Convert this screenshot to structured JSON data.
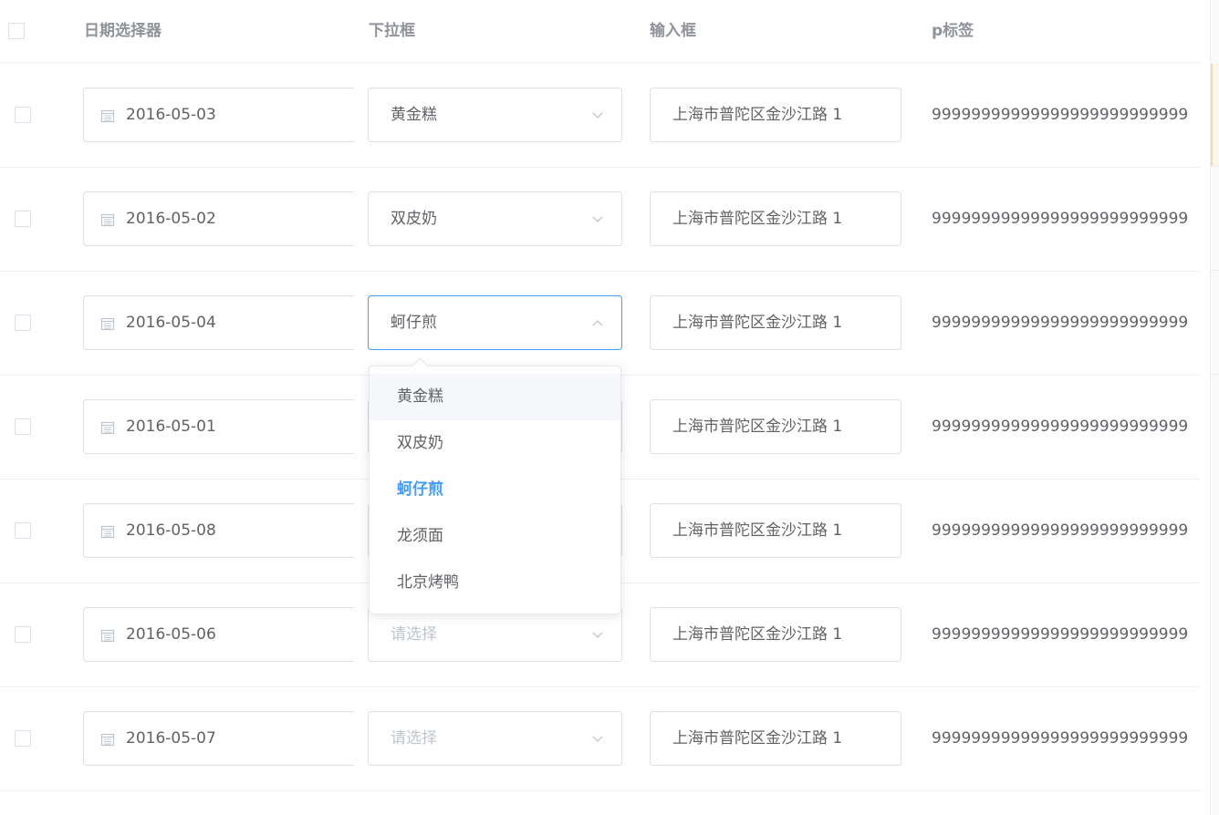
{
  "table": {
    "headers": {
      "date": "日期选择器",
      "select": "下拉框",
      "input": "输入框",
      "p": "p标签"
    },
    "rows": [
      {
        "date": "2016-05-03",
        "select": "黄金糕",
        "input": "上海市普陀区金沙江路 1",
        "p": "99999999999999999999999999"
      },
      {
        "date": "2016-05-02",
        "select": "双皮奶",
        "input": "上海市普陀区金沙江路 1",
        "p": "99999999999999999999999999"
      },
      {
        "date": "2016-05-04",
        "select": "蚵仔煎",
        "input": "上海市普陀区金沙江路 1",
        "p": "99999999999999999999999999"
      },
      {
        "date": "2016-05-01",
        "select": "",
        "input": "上海市普陀区金沙江路 1",
        "p": "99999999999999999999999999"
      },
      {
        "date": "2016-05-08",
        "select": "",
        "input": "上海市普陀区金沙江路 1",
        "p": "99999999999999999999999999"
      },
      {
        "date": "2016-05-06",
        "select": "请选择",
        "input": "上海市普陀区金沙江路 1",
        "p": "99999999999999999999999999"
      },
      {
        "date": "2016-05-07",
        "select": "请选择",
        "input": "上海市普陀区金沙江路 1",
        "p": "99999999999999999999999999"
      }
    ]
  },
  "dropdown": {
    "options": [
      "黄金糕",
      "双皮奶",
      "蚵仔煎",
      "龙须面",
      "北京烤鸭"
    ],
    "selected": "蚵仔煎",
    "hovered": "黄金糕"
  },
  "colors": {
    "accent": "#409eff",
    "border": "#dcdfe6",
    "text": "#606266",
    "placeholder": "#c0c4cc",
    "header_text": "#909399"
  },
  "icons": {
    "date": "calendar-icon",
    "select_closed": "chevron-down-icon",
    "select_open": "chevron-up-icon"
  }
}
